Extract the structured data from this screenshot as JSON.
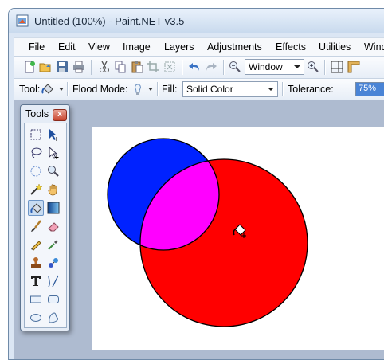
{
  "window": {
    "title": "Untitled (100%) - Paint.NET v3.5"
  },
  "menu": [
    "File",
    "Edit",
    "View",
    "Image",
    "Layers",
    "Adjustments",
    "Effects",
    "Utilities",
    "Windo"
  ],
  "toolbar1": {
    "zoom_mode": "Window",
    "icons": [
      "new-image-icon",
      "open-icon",
      "save-icon",
      "print-icon",
      "cut-icon",
      "copy-icon",
      "paste-icon",
      "crop-icon",
      "deselect-icon",
      "undo-icon",
      "redo-icon",
      "zoom-out-icon",
      "zoom-in-icon",
      "grid-icon",
      "ruler-icon"
    ]
  },
  "toolbar2": {
    "tool_label": "Tool:",
    "flood_mode_label": "Flood Mode:",
    "fill_label": "Fill:",
    "fill_value": "Solid Color",
    "tolerance_label": "Tolerance:",
    "tolerance_value": "75%",
    "tolerance_fraction": 0.75
  },
  "tools_window": {
    "title": "Tools",
    "close": "x",
    "selected_tool": "paint-bucket",
    "tools": [
      "rectangle-select",
      "move-selection",
      "lasso-select",
      "move-selection-outline",
      "ellipse-select",
      "zoom",
      "magic-wand",
      "pan",
      "paint-bucket",
      "gradient",
      "paintbrush",
      "eraser",
      "pencil",
      "color-picker",
      "clone-stamp",
      "recolor",
      "text",
      "line-curve",
      "rectangle",
      "rounded-rectangle",
      "ellipse",
      "freeform-shape"
    ]
  },
  "canvas": {
    "background": "#ffffff",
    "circle_blue_color": "#0022ff",
    "circle_red_color": "#ff0000",
    "overlap_color": "#ff00ff"
  }
}
